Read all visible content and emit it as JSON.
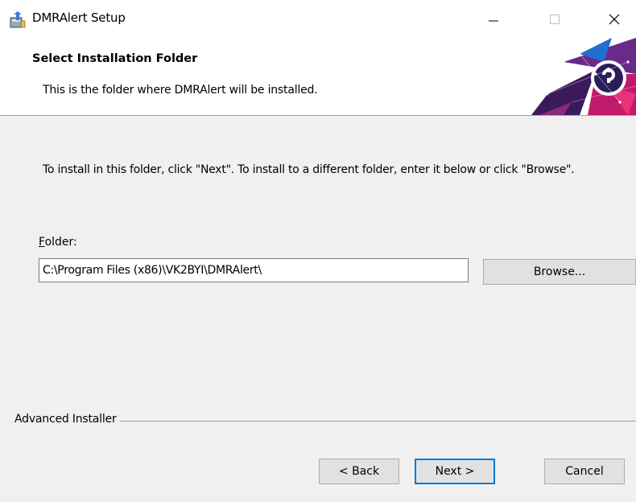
{
  "window": {
    "title": "DMRAlert Setup",
    "minimize_glyph": "—",
    "maximize_glyph": "☐",
    "close_glyph": "✕"
  },
  "banner": {
    "title": "Select Installation Folder",
    "subtitle": "This is the folder where DMRAlert will be installed."
  },
  "main": {
    "instructions": "To install in this folder, click \"Next\". To install to a different folder, enter it below or click \"Browse\".",
    "folder_label_accel": "F",
    "folder_label_rest": "older:",
    "folder_value": "C:\\Program Files (x86)\\VK2BYI\\DMRAlert\\",
    "browse_label": "Browse..."
  },
  "footer": {
    "brand": "Advanced Installer",
    "back_label": "< Back",
    "next_label": "Next >",
    "cancel_label": "Cancel"
  },
  "colors": {
    "accent": "#0078d7",
    "banner_purple": "#5b1f6e",
    "banner_magenta": "#c21a6b",
    "banner_blue": "#1f6fd1"
  },
  "icons": {
    "app": "installer-box-icon",
    "banner": "abstract-logo-art"
  }
}
